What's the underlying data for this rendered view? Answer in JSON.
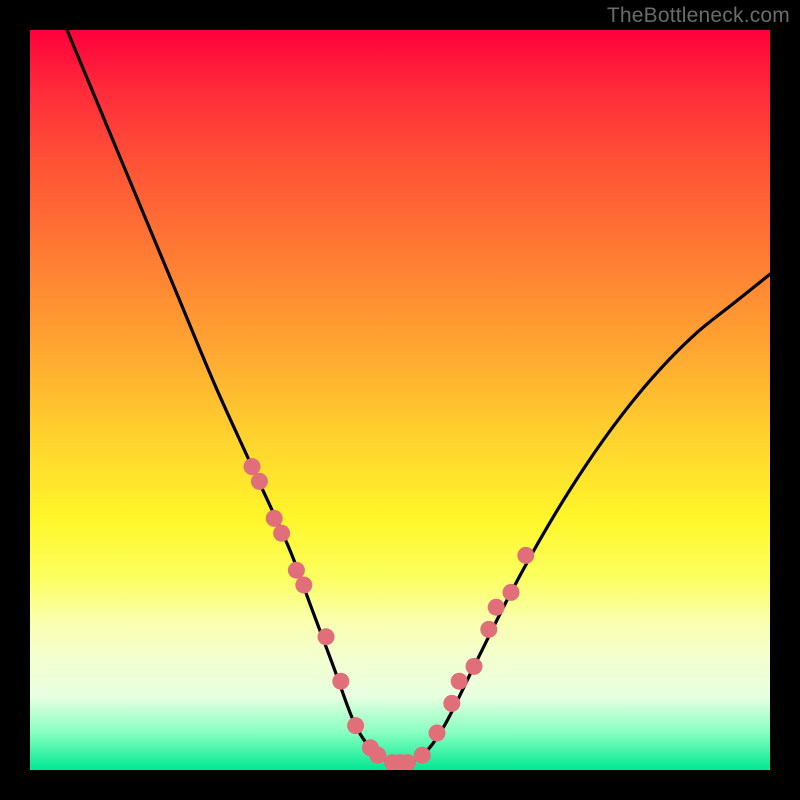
{
  "watermark": "TheBottleneck.com",
  "chart_data": {
    "type": "line",
    "title": "",
    "xlabel": "",
    "ylabel": "",
    "xlim": [
      0,
      100
    ],
    "ylim": [
      0,
      100
    ],
    "series": [
      {
        "name": "bottleneck-curve",
        "x": [
          5,
          10,
          15,
          20,
          25,
          30,
          35,
          38,
          41,
          44,
          47,
          50,
          53,
          56,
          60,
          65,
          70,
          75,
          80,
          85,
          90,
          95,
          100
        ],
        "y": [
          100,
          88,
          76,
          64,
          52,
          41,
          30,
          22,
          14,
          6,
          2,
          1,
          2,
          6,
          14,
          24,
          33,
          41,
          48,
          54,
          59,
          63,
          67
        ]
      }
    ],
    "markers": {
      "name": "highlight-dots",
      "color": "#e06f7a",
      "x": [
        30,
        31,
        33,
        34,
        36,
        37,
        40,
        42,
        44,
        46,
        47,
        49,
        50,
        51,
        53,
        55,
        57,
        58,
        60,
        62,
        63,
        65,
        67
      ],
      "y": [
        41,
        39,
        34,
        32,
        27,
        25,
        18,
        12,
        6,
        3,
        2,
        1,
        1,
        1,
        2,
        5,
        9,
        12,
        14,
        19,
        22,
        24,
        29
      ]
    },
    "gradient_stops": [
      {
        "pos": 0.0,
        "color": "#ff003c"
      },
      {
        "pos": 0.3,
        "color": "#ff7a34"
      },
      {
        "pos": 0.6,
        "color": "#ffe82a"
      },
      {
        "pos": 0.82,
        "color": "#faffb0"
      },
      {
        "pos": 1.0,
        "color": "#00e893"
      }
    ]
  }
}
